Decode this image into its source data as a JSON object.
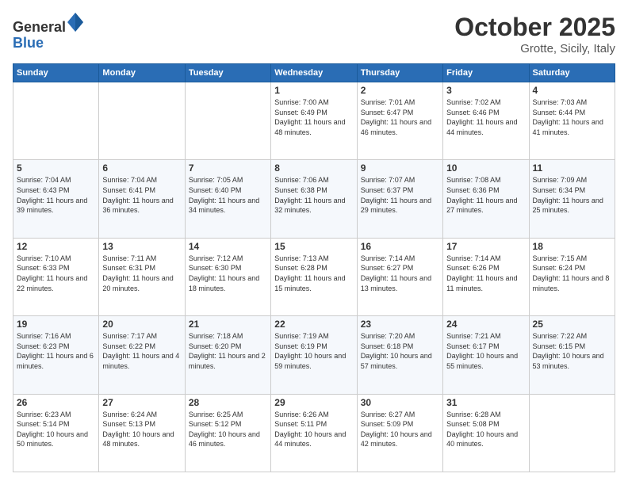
{
  "logo": {
    "general": "General",
    "blue": "Blue"
  },
  "header": {
    "month": "October 2025",
    "location": "Grotte, Sicily, Italy"
  },
  "weekdays": [
    "Sunday",
    "Monday",
    "Tuesday",
    "Wednesday",
    "Thursday",
    "Friday",
    "Saturday"
  ],
  "weeks": [
    [
      {
        "day": "",
        "info": ""
      },
      {
        "day": "",
        "info": ""
      },
      {
        "day": "",
        "info": ""
      },
      {
        "day": "1",
        "info": "Sunrise: 7:00 AM\nSunset: 6:49 PM\nDaylight: 11 hours\nand 48 minutes."
      },
      {
        "day": "2",
        "info": "Sunrise: 7:01 AM\nSunset: 6:47 PM\nDaylight: 11 hours\nand 46 minutes."
      },
      {
        "day": "3",
        "info": "Sunrise: 7:02 AM\nSunset: 6:46 PM\nDaylight: 11 hours\nand 44 minutes."
      },
      {
        "day": "4",
        "info": "Sunrise: 7:03 AM\nSunset: 6:44 PM\nDaylight: 11 hours\nand 41 minutes."
      }
    ],
    [
      {
        "day": "5",
        "info": "Sunrise: 7:04 AM\nSunset: 6:43 PM\nDaylight: 11 hours\nand 39 minutes."
      },
      {
        "day": "6",
        "info": "Sunrise: 7:04 AM\nSunset: 6:41 PM\nDaylight: 11 hours\nand 36 minutes."
      },
      {
        "day": "7",
        "info": "Sunrise: 7:05 AM\nSunset: 6:40 PM\nDaylight: 11 hours\nand 34 minutes."
      },
      {
        "day": "8",
        "info": "Sunrise: 7:06 AM\nSunset: 6:38 PM\nDaylight: 11 hours\nand 32 minutes."
      },
      {
        "day": "9",
        "info": "Sunrise: 7:07 AM\nSunset: 6:37 PM\nDaylight: 11 hours\nand 29 minutes."
      },
      {
        "day": "10",
        "info": "Sunrise: 7:08 AM\nSunset: 6:36 PM\nDaylight: 11 hours\nand 27 minutes."
      },
      {
        "day": "11",
        "info": "Sunrise: 7:09 AM\nSunset: 6:34 PM\nDaylight: 11 hours\nand 25 minutes."
      }
    ],
    [
      {
        "day": "12",
        "info": "Sunrise: 7:10 AM\nSunset: 6:33 PM\nDaylight: 11 hours\nand 22 minutes."
      },
      {
        "day": "13",
        "info": "Sunrise: 7:11 AM\nSunset: 6:31 PM\nDaylight: 11 hours\nand 20 minutes."
      },
      {
        "day": "14",
        "info": "Sunrise: 7:12 AM\nSunset: 6:30 PM\nDaylight: 11 hours\nand 18 minutes."
      },
      {
        "day": "15",
        "info": "Sunrise: 7:13 AM\nSunset: 6:28 PM\nDaylight: 11 hours\nand 15 minutes."
      },
      {
        "day": "16",
        "info": "Sunrise: 7:14 AM\nSunset: 6:27 PM\nDaylight: 11 hours\nand 13 minutes."
      },
      {
        "day": "17",
        "info": "Sunrise: 7:14 AM\nSunset: 6:26 PM\nDaylight: 11 hours\nand 11 minutes."
      },
      {
        "day": "18",
        "info": "Sunrise: 7:15 AM\nSunset: 6:24 PM\nDaylight: 11 hours\nand 8 minutes."
      }
    ],
    [
      {
        "day": "19",
        "info": "Sunrise: 7:16 AM\nSunset: 6:23 PM\nDaylight: 11 hours\nand 6 minutes."
      },
      {
        "day": "20",
        "info": "Sunrise: 7:17 AM\nSunset: 6:22 PM\nDaylight: 11 hours\nand 4 minutes."
      },
      {
        "day": "21",
        "info": "Sunrise: 7:18 AM\nSunset: 6:20 PM\nDaylight: 11 hours\nand 2 minutes."
      },
      {
        "day": "22",
        "info": "Sunrise: 7:19 AM\nSunset: 6:19 PM\nDaylight: 10 hours\nand 59 minutes."
      },
      {
        "day": "23",
        "info": "Sunrise: 7:20 AM\nSunset: 6:18 PM\nDaylight: 10 hours\nand 57 minutes."
      },
      {
        "day": "24",
        "info": "Sunrise: 7:21 AM\nSunset: 6:17 PM\nDaylight: 10 hours\nand 55 minutes."
      },
      {
        "day": "25",
        "info": "Sunrise: 7:22 AM\nSunset: 6:15 PM\nDaylight: 10 hours\nand 53 minutes."
      }
    ],
    [
      {
        "day": "26",
        "info": "Sunrise: 6:23 AM\nSunset: 5:14 PM\nDaylight: 10 hours\nand 50 minutes."
      },
      {
        "day": "27",
        "info": "Sunrise: 6:24 AM\nSunset: 5:13 PM\nDaylight: 10 hours\nand 48 minutes."
      },
      {
        "day": "28",
        "info": "Sunrise: 6:25 AM\nSunset: 5:12 PM\nDaylight: 10 hours\nand 46 minutes."
      },
      {
        "day": "29",
        "info": "Sunrise: 6:26 AM\nSunset: 5:11 PM\nDaylight: 10 hours\nand 44 minutes."
      },
      {
        "day": "30",
        "info": "Sunrise: 6:27 AM\nSunset: 5:09 PM\nDaylight: 10 hours\nand 42 minutes."
      },
      {
        "day": "31",
        "info": "Sunrise: 6:28 AM\nSunset: 5:08 PM\nDaylight: 10 hours\nand 40 minutes."
      },
      {
        "day": "",
        "info": ""
      }
    ]
  ]
}
